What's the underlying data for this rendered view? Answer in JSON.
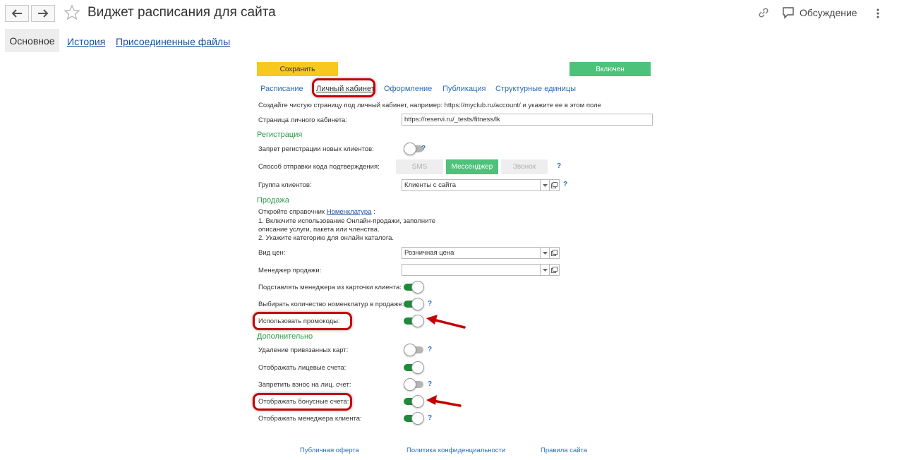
{
  "header": {
    "title": "Виджет расписания для сайта",
    "discussion_label": "Обсуждение"
  },
  "top_tabs": {
    "active": "Основное",
    "history": "История",
    "attachments": "Присоединенные файлы"
  },
  "actions": {
    "save_label": "Сохранить",
    "enabled_label": "Включен"
  },
  "widget_tabs": {
    "schedule": "Расписание",
    "account": "Личный кабинет",
    "design": "Оформление",
    "publication": "Публикация",
    "units": "Структурные единицы",
    "active": "Личный кабинет"
  },
  "account": {
    "hint": "Создайте чистую страницу под личный кабинет, например: https://myclub.ru/account/ и укажите ее в этом поле",
    "page_label": "Страница личного кабинета:",
    "page_value": "https://reservi.ru/_tests/fitness/lk"
  },
  "registration": {
    "section": "Регистрация",
    "block_new_label": "Запрет регистрации новых клиентов:",
    "block_new_on": false,
    "code_method_label": "Способ отправки кода подтверждения:",
    "code_methods": [
      "SMS",
      "Мессенджер",
      "Звонок"
    ],
    "code_method_selected": "Мессенджер",
    "group_label": "Группа клиентов:",
    "group_value": "Клиенты с сайта"
  },
  "sales": {
    "section": "Продажа",
    "note_prefix": "Откройте справочник",
    "note_link": "Номенклатура",
    "note_suffix": ":",
    "note_line1": "1. Включите использование Онлайн-продажи, заполните",
    "note_line2": "описание услуги, пакета или членства.",
    "note_line3": "2. Укажите категорию для онлайн каталога.",
    "price_type_label": "Вид цен:",
    "price_type_value": "Розничная цена",
    "manager_label": "Менеджер продажи:",
    "manager_value": "",
    "substitute_manager_label": "Подставлять менеджера из карточки клиента:",
    "substitute_manager_on": true,
    "choose_qty_label": "Выбирать количество номенклатур в продаже:",
    "choose_qty_on": true,
    "promocodes_label": "Использовать промокоды:",
    "promocodes_on": true
  },
  "extra": {
    "section": "Дополнительно",
    "delete_cards_label": "Удаление привязанных карт:",
    "delete_cards_on": false,
    "show_accounts_label": "Отображать лицевые счета:",
    "show_accounts_on": true,
    "forbid_deposit_label": "Запретить взнос на лиц. счет:",
    "forbid_deposit_on": false,
    "show_bonus_label": "Отображать бонусные счета:",
    "show_bonus_on": true,
    "show_manager_label": "Отображать менеджера клиента:",
    "show_manager_on": true
  },
  "help_mark": "?",
  "footer": {
    "offer": "Публичная оферта",
    "privacy": "Политика конфиденциальности",
    "rules": "Правила сайта"
  },
  "colors": {
    "save": "#f7c81e",
    "enabled": "#4cc27a",
    "toggle_on": "#1f8a3c",
    "section": "#2f9a4c",
    "highlight": "#c40000"
  },
  "icons": [
    "back-arrow-icon",
    "forward-arrow-icon",
    "star-icon",
    "link-icon",
    "comment-icon",
    "more-vert-icon",
    "dropdown-arrow-icon",
    "open-form-icon"
  ]
}
